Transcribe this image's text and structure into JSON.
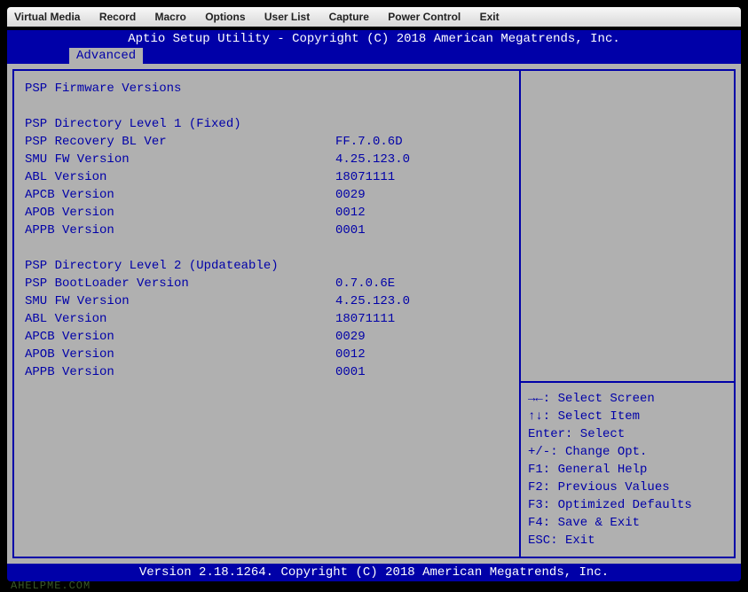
{
  "menubar": [
    "Virtual Media",
    "Record",
    "Macro",
    "Options",
    "User List",
    "Capture",
    "Power Control",
    "Exit"
  ],
  "header": "Aptio Setup Utility - Copyright (C) 2018 American Megatrends, Inc.",
  "tab": "Advanced",
  "title": "PSP Firmware Versions",
  "section1": {
    "heading": "PSP Directory Level 1 (Fixed)",
    "rows": [
      {
        "label": "PSP Recovery BL Ver",
        "value": "FF.7.0.6D"
      },
      {
        "label": "SMU FW Version",
        "value": "4.25.123.0"
      },
      {
        "label": "ABL Version",
        "value": "18071111"
      },
      {
        "label": "APCB Version",
        "value": "0029"
      },
      {
        "label": "APOB Version",
        "value": "0012"
      },
      {
        "label": "APPB Version",
        "value": "0001"
      }
    ]
  },
  "section2": {
    "heading": "PSP Directory Level 2 (Updateable)",
    "rows": [
      {
        "label": "PSP BootLoader Version",
        "value": "0.7.0.6E"
      },
      {
        "label": "SMU FW Version",
        "value": "4.25.123.0"
      },
      {
        "label": "ABL Version",
        "value": "18071111"
      },
      {
        "label": "APCB Version",
        "value": "0029"
      },
      {
        "label": "APOB Version",
        "value": "0012"
      },
      {
        "label": "APPB Version",
        "value": "0001"
      }
    ]
  },
  "help": {
    "l1": "→←: Select Screen",
    "l2": "↑↓: Select Item",
    "l3": "Enter: Select",
    "l4": "+/-: Change Opt.",
    "l5": "F1: General Help",
    "l6": "F2: Previous Values",
    "l7": "F3: Optimized Defaults",
    "l8": "F4: Save & Exit",
    "l9": "ESC: Exit"
  },
  "footer": "Version 2.18.1264. Copyright (C) 2018 American Megatrends, Inc.",
  "watermark": "AHELPME.COM"
}
